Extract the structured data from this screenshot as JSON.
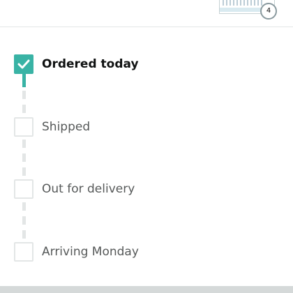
{
  "header": {
    "item_count": "4"
  },
  "tracker": {
    "steps": [
      {
        "label": "Ordered today",
        "status": "complete"
      },
      {
        "label": "Shipped",
        "status": "pending"
      },
      {
        "label": "Out for delivery",
        "status": "pending"
      },
      {
        "label": "Arriving Monday",
        "status": "pending"
      }
    ],
    "colors": {
      "complete": "#39b3a5",
      "pending": "#e3e6e6",
      "active_text": "#0f1111",
      "pending_text": "#565959"
    }
  }
}
